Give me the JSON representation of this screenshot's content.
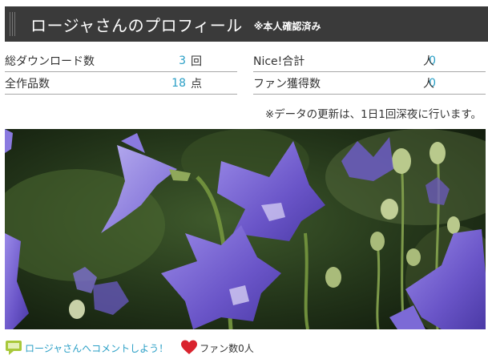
{
  "profile": {
    "title": "ロージャさんのプロフィール",
    "verified_badge": "※本人確認済み"
  },
  "stats_left": [
    {
      "label": "総ダウンロード数",
      "value": "3",
      "unit": "回"
    },
    {
      "label": "全作品数",
      "value": "18",
      "unit": "点"
    }
  ],
  "stats_right": [
    {
      "label": "Nice!合計",
      "value": "0",
      "unit": "人"
    },
    {
      "label": "ファン獲得数",
      "value": "0",
      "unit": "人"
    }
  ],
  "notice": "※データの更新は、1日1回深夜に行います。",
  "footer": {
    "comment_link": "ロージャさんへコメントしよう！",
    "fan_count": "ファン数0人"
  },
  "colors": {
    "header_bg": "#3a3a3a",
    "value_accent": "#2a9fc6",
    "heart": "#d9232e",
    "bubble": "#a8c83a"
  },
  "icons": {
    "comment": "speech-bubble-icon",
    "fans": "heart-icon"
  }
}
